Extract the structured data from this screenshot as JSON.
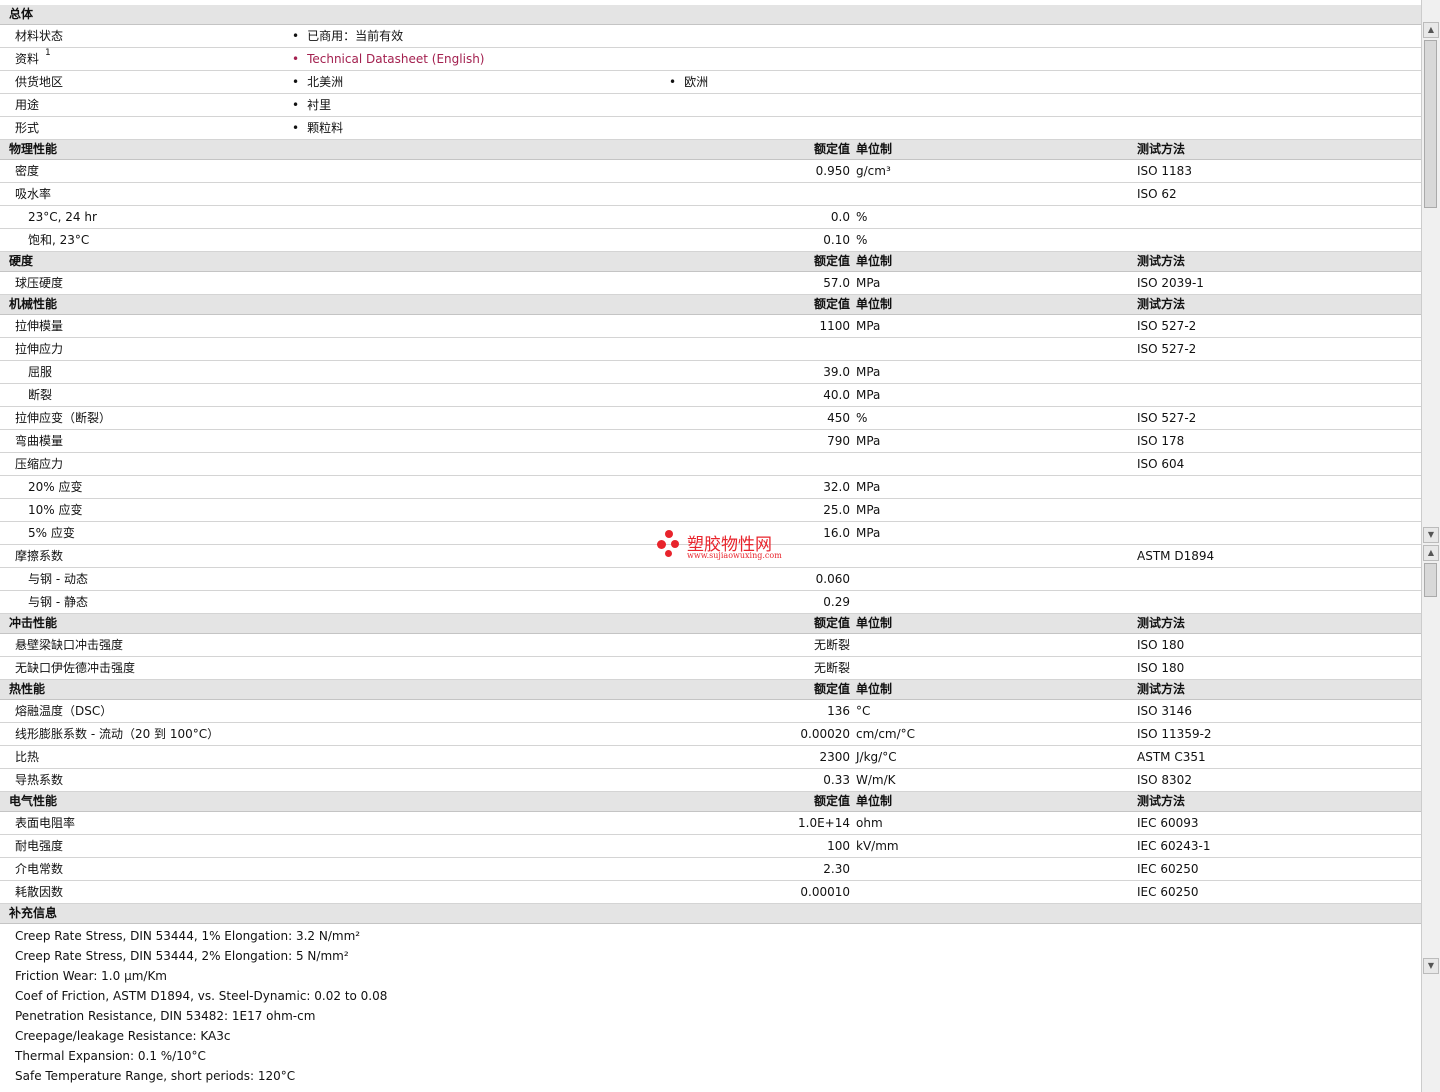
{
  "general": {
    "title": "总体",
    "rows": [
      {
        "label": "材料状态",
        "b1": "已商用：当前有效"
      },
      {
        "label": "资料",
        "sup": "1",
        "b1": "Technical Datasheet (English)",
        "link": true
      },
      {
        "label": "供货地区",
        "b1": "北美洲",
        "b2": "欧洲"
      },
      {
        "label": "用途",
        "b1": "衬里"
      },
      {
        "label": "形式",
        "b1": "颗粒料"
      }
    ]
  },
  "columns": {
    "value": "额定值",
    "unit": "单位制",
    "test": "测试方法"
  },
  "sections": [
    {
      "title": "物理性能",
      "rows": [
        {
          "label": "密度",
          "value": "0.950",
          "unit": "g/cm³",
          "test": "ISO 1183"
        },
        {
          "label": "吸水率",
          "value": "",
          "unit": "",
          "test": "ISO 62"
        },
        {
          "label": "23°C, 24 hr",
          "sub": true,
          "value": "0.0",
          "unit": "%",
          "test": ""
        },
        {
          "label": "饱和, 23°C",
          "sub": true,
          "value": "0.10",
          "unit": "%",
          "test": ""
        }
      ]
    },
    {
      "title": "硬度",
      "rows": [
        {
          "label": "球压硬度",
          "value": "57.0",
          "unit": "MPa",
          "test": "ISO 2039-1"
        }
      ]
    },
    {
      "title": "机械性能",
      "rows": [
        {
          "label": "拉伸模量",
          "value": "1100",
          "unit": "MPa",
          "test": "ISO 527-2"
        },
        {
          "label": "拉伸应力",
          "value": "",
          "unit": "",
          "test": "ISO 527-2"
        },
        {
          "label": "屈服",
          "sub": true,
          "value": "39.0",
          "unit": "MPa",
          "test": ""
        },
        {
          "label": "断裂",
          "sub": true,
          "value": "40.0",
          "unit": "MPa",
          "test": ""
        },
        {
          "label": "拉伸应变（断裂）",
          "value": "450",
          "unit": "%",
          "test": "ISO 527-2"
        },
        {
          "label": "弯曲模量",
          "value": "790",
          "unit": "MPa",
          "test": "ISO 178"
        },
        {
          "label": "压缩应力",
          "value": "",
          "unit": "",
          "test": "ISO 604"
        },
        {
          "label": "20% 应变",
          "sub": true,
          "value": "32.0",
          "unit": "MPa",
          "test": ""
        },
        {
          "label": "10% 应变",
          "sub": true,
          "value": "25.0",
          "unit": "MPa",
          "test": ""
        },
        {
          "label": "5% 应变",
          "sub": true,
          "value": "16.0",
          "unit": "MPa",
          "test": ""
        },
        {
          "label": "摩擦系数",
          "value": "",
          "unit": "",
          "test": "ASTM D1894"
        },
        {
          "label": "与钢 - 动态",
          "sub": true,
          "value": "0.060",
          "unit": "",
          "test": ""
        },
        {
          "label": "与钢 - 静态",
          "sub": true,
          "value": "0.29",
          "unit": "",
          "test": ""
        }
      ]
    },
    {
      "title": "冲击性能",
      "rows": [
        {
          "label": "悬壁梁缺口冲击强度",
          "value": "无断裂",
          "unit": "",
          "test": "ISO 180"
        },
        {
          "label": "无缺口伊佐德冲击强度",
          "value": "无断裂",
          "unit": "",
          "test": "ISO 180"
        }
      ]
    },
    {
      "title": "热性能",
      "rows": [
        {
          "label": "熔融温度（DSC）",
          "value": "136",
          "unit": "°C",
          "test": "ISO 3146"
        },
        {
          "label": "线形膨胀系数 - 流动（20 到 100°C）",
          "value": "0.00020",
          "unit": "cm/cm/°C",
          "test": "ISO 11359-2"
        },
        {
          "label": "比热",
          "value": "2300",
          "unit": "J/kg/°C",
          "test": "ASTM C351"
        },
        {
          "label": "导热系数",
          "value": "0.33",
          "unit": "W/m/K",
          "test": "ISO 8302"
        }
      ]
    },
    {
      "title": "电气性能",
      "rows": [
        {
          "label": "表面电阻率",
          "value": "1.0E+14",
          "unit": "ohm",
          "test": "IEC 60093"
        },
        {
          "label": "耐电强度",
          "value": "100",
          "unit": "kV/mm",
          "test": "IEC 60243-1"
        },
        {
          "label": "介电常数",
          "value": "2.30",
          "unit": "",
          "test": "IEC 60250"
        },
        {
          "label": "耗散因数",
          "value": "0.00010",
          "unit": "",
          "test": "IEC 60250"
        }
      ]
    }
  ],
  "supplemental": {
    "title": "补充信息",
    "lines": [
      "Creep Rate Stress, DIN 53444, 1% Elongation: 3.2 N/mm²",
      "Creep Rate Stress, DIN 53444, 2% Elongation: 5 N/mm²",
      "Friction Wear: 1.0 μm/Km",
      "Coef of Friction, ASTM D1894, vs. Steel-Dynamic: 0.02 to 0.08",
      "Penetration Resistance, DIN 53482: 1E17 ohm-cm",
      "Creepage/leakage Resistance: KA3c",
      "Thermal Expansion: 0.1 %/10°C",
      "Safe Temperature Range, short periods: 120°C"
    ]
  },
  "watermark": {
    "title": "塑胶物性网",
    "url": "www.sujiaowuxing.com"
  },
  "scrollbar": {
    "icons": [
      "arrow-up-icon",
      "arrow-down-icon"
    ]
  },
  "colors": {
    "link": "#a3204f",
    "header_bg": "#e4e4e4",
    "watermark": "#e8242c"
  }
}
